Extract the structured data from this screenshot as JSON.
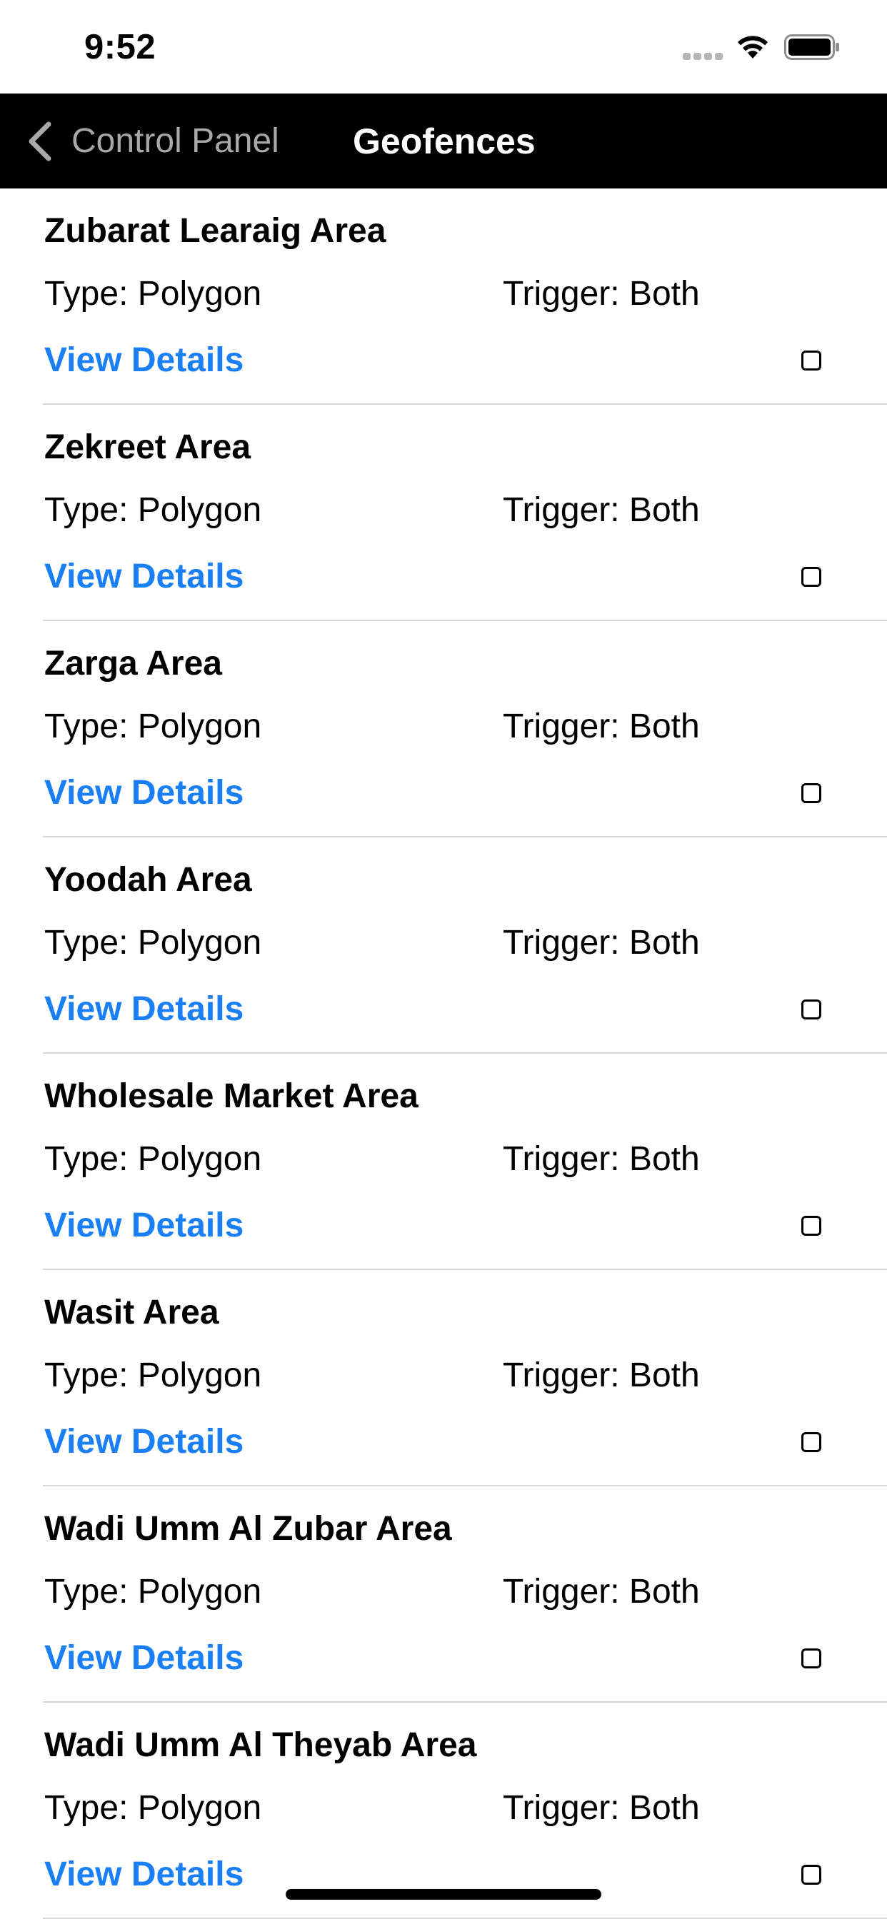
{
  "status_bar": {
    "time": "9:52",
    "icons": [
      "cellular-signal-icon",
      "wifi-icon",
      "battery-icon"
    ]
  },
  "nav": {
    "back_label": "Control Panel",
    "back_icon": "chevron-left-icon",
    "title": "Geofences"
  },
  "colors": {
    "nav_background": "#000000",
    "link": "#1a7ff5",
    "back_label": "#a8a8a8",
    "separator": "#d8d8dc"
  },
  "geofences": [
    {
      "name": "Zubarat Learaig Area",
      "type": "Type: Polygon",
      "trigger": "Trigger: Both",
      "link": "View Details",
      "checked": false
    },
    {
      "name": "Zekreet Area",
      "type": "Type: Polygon",
      "trigger": "Trigger: Both",
      "link": "View Details",
      "checked": false
    },
    {
      "name": "Zarga Area",
      "type": "Type: Polygon",
      "trigger": "Trigger: Both",
      "link": "View Details",
      "checked": false
    },
    {
      "name": "Yoodah Area",
      "type": "Type: Polygon",
      "trigger": "Trigger: Both",
      "link": "View Details",
      "checked": false
    },
    {
      "name": "Wholesale Market Area",
      "type": "Type: Polygon",
      "trigger": "Trigger: Both",
      "link": "View Details",
      "checked": false
    },
    {
      "name": "Wasit Area",
      "type": "Type: Polygon",
      "trigger": "Trigger: Both",
      "link": "View Details",
      "checked": false
    },
    {
      "name": "Wadi Umm Al Zubar Area",
      "type": "Type: Polygon",
      "trigger": "Trigger: Both",
      "link": "View Details",
      "checked": false
    },
    {
      "name": "Wadi Umm Al Theyab Area",
      "type": "Type: Polygon",
      "trigger": "Trigger: Both",
      "link": "View Details",
      "checked": false
    }
  ]
}
